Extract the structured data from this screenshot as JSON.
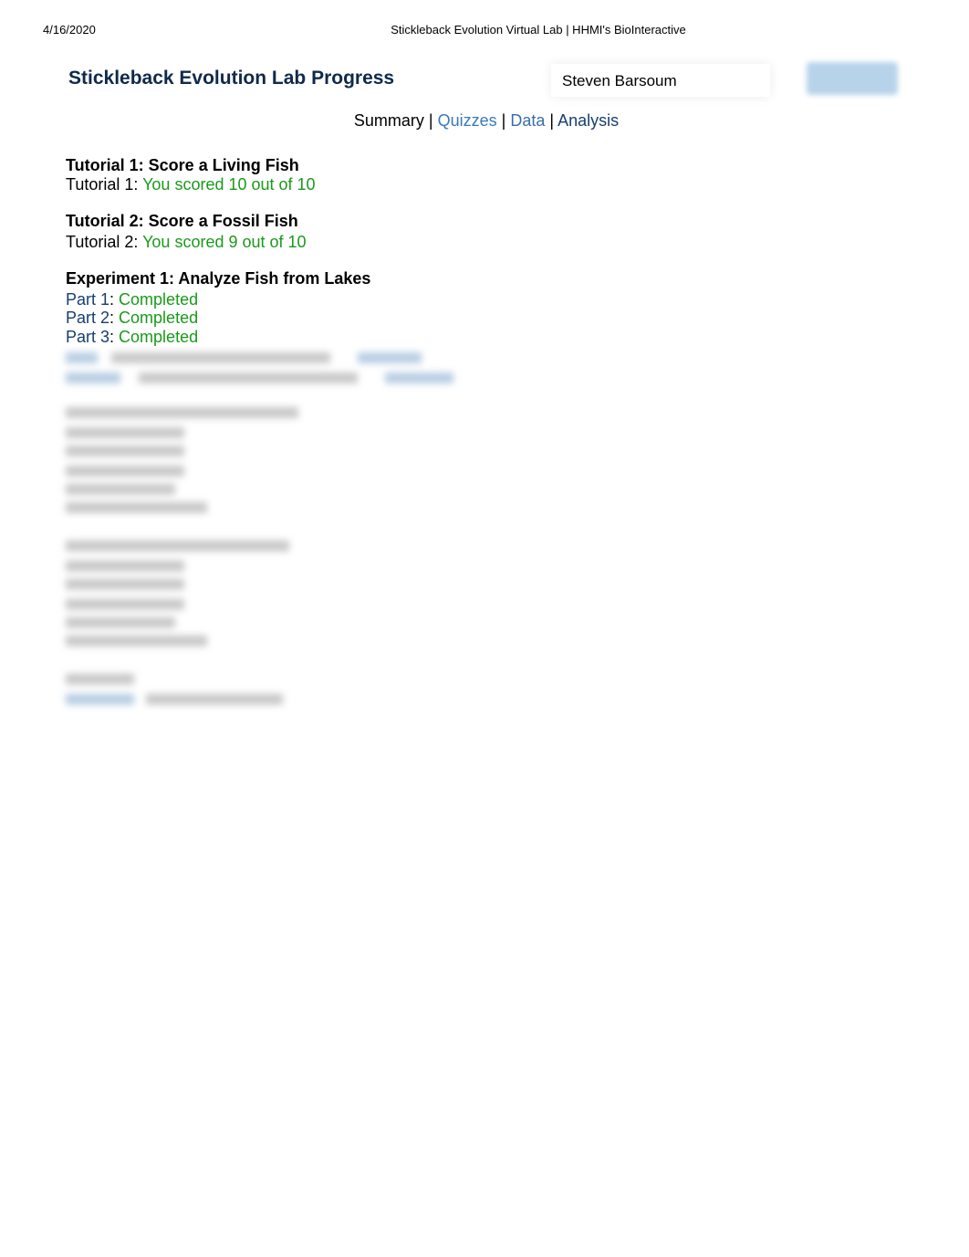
{
  "print_header": {
    "date": "4/16/2020",
    "page_title": "Stickleback Evolution Virtual Lab | HHMI's BioInteractive"
  },
  "header": {
    "title": "Stickleback Evolution Lab Progress",
    "user_name": "Steven Barsoum"
  },
  "nav": {
    "summary": "Summary",
    "sep": "|",
    "quizzes": "Quizzes",
    "data": "Data",
    "analysis": "Analysis"
  },
  "tutorial1": {
    "heading": "Tutorial 1: Score a Living Fish",
    "label": "Tutorial 1:",
    "result": "You scored 10 out of 10"
  },
  "tutorial2": {
    "heading": "Tutorial 2: Score a Fossil Fish",
    "label": "Tutorial 2:",
    "result": "You scored 9 out of 10"
  },
  "experiment1": {
    "heading": "Experiment 1: Analyze Fish from Lakes",
    "parts": [
      {
        "label": "Part 1",
        "status": "Completed"
      },
      {
        "label": "Part 2",
        "status": "Completed"
      },
      {
        "label": "Part 3",
        "status": "Completed"
      }
    ]
  },
  "colors": {
    "title": "#0f2a4a",
    "success": "#1a9a1a",
    "link": "#173e6e"
  }
}
